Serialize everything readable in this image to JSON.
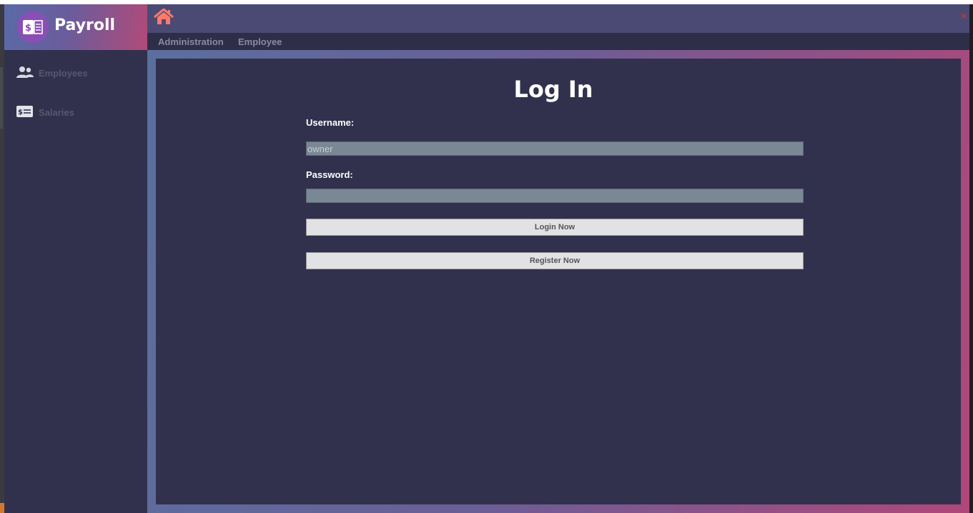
{
  "app": {
    "title": "Payroll"
  },
  "sidebar": {
    "items": [
      {
        "label": "Employees",
        "icon": "users-icon"
      },
      {
        "label": "Salaries",
        "icon": "salary-card-icon"
      }
    ]
  },
  "topbar": {
    "home_icon": "home-icon",
    "close_icon": "close-icon",
    "close_symbol": "×"
  },
  "menu": [
    {
      "label": "Administration"
    },
    {
      "label": "Employee"
    }
  ],
  "login": {
    "title": "Log In",
    "username_label": "Username:",
    "username_value": "owner",
    "password_label": "Password:",
    "password_value": "",
    "login_button": "Login Now",
    "register_button": "Register Now"
  },
  "colors": {
    "accent": "#ff7a6b",
    "background": "#31314d",
    "topbar": "#4a4a75",
    "close": "#c0392b"
  }
}
